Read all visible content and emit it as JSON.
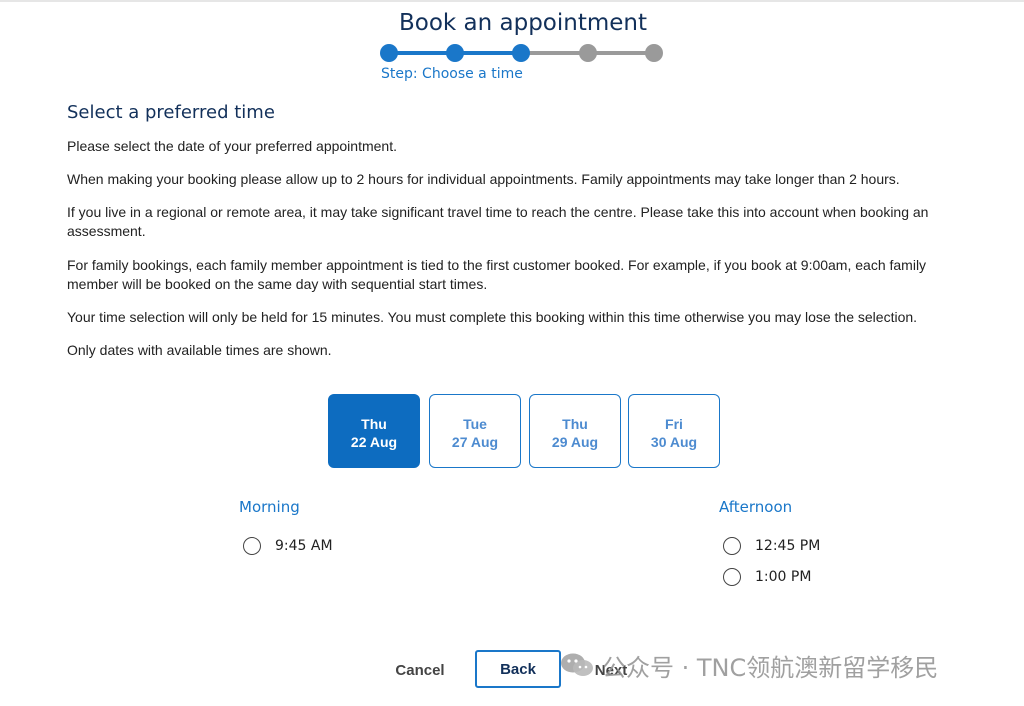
{
  "header": {
    "title": "Book an appointment",
    "step_caption": "Step: Choose a time",
    "steps_total": 5,
    "steps_completed": 3
  },
  "section": {
    "heading": "Select a preferred time",
    "paragraphs": [
      "Please select the date of your preferred appointment.",
      "When making your booking please allow up to 2 hours for individual appointments. Family appointments may take longer than 2 hours.",
      "If you live in a regional or remote area, it may take significant travel time to reach the centre. Please take this into account when booking an assessment.",
      "For family bookings, each family member appointment is tied to the first customer booked. For example, if you book at 9:00am, each family member will be booked on the same day with sequential start times.",
      "Your time selection will only be held for 15 minutes. You must complete this booking within this time otherwise you may lose the selection.",
      "Only dates with available times are shown."
    ]
  },
  "dates": [
    {
      "day": "Thu",
      "date": "22 Aug",
      "selected": true
    },
    {
      "day": "Tue",
      "date": "27 Aug",
      "selected": false
    },
    {
      "day": "Thu",
      "date": "29 Aug",
      "selected": false
    },
    {
      "day": "Fri",
      "date": "30 Aug",
      "selected": false
    }
  ],
  "morning": {
    "label": "Morning",
    "slots": [
      "9:45 AM"
    ]
  },
  "afternoon": {
    "label": "Afternoon",
    "slots": [
      "12:45 PM",
      "1:00 PM"
    ]
  },
  "actions": {
    "cancel": "Cancel",
    "back": "Back",
    "next": "Next"
  },
  "watermark": "公众号 · TNC领航澳新留学移民",
  "colors": {
    "primary": "#1a77c9",
    "selected_tile": "#0d6cc0",
    "heading": "#12305a",
    "inactive_step": "#9a9a9a"
  }
}
